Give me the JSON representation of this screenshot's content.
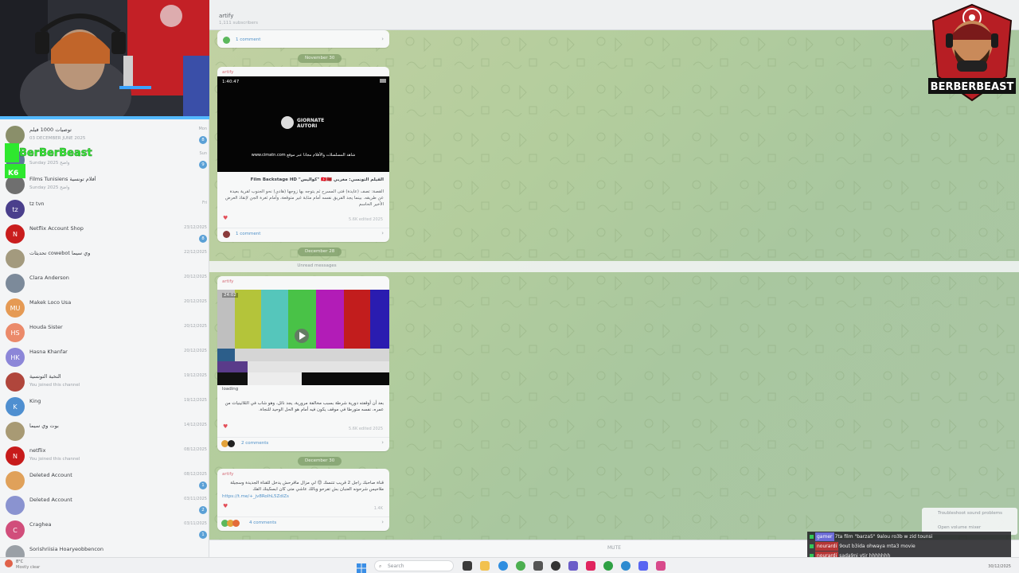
{
  "sidebar": {
    "chats": [
      {
        "name": "توصيات 1000 فيلم",
        "preview": "03 DECEMBER JUNE 2025",
        "date": "Mon",
        "badge": "8",
        "avatar_color": "#8a8f6a",
        "avatar_text": ""
      },
      {
        "name": "",
        "preview": "Sunday 2025 واضح",
        "date": "Sun",
        "badge": "9",
        "avatar_color": "#5d7a98",
        "avatar_text": ""
      },
      {
        "name": "Films Tunisiens أفلام تونسية",
        "preview": "Sunday 2025 واضح",
        "date": "",
        "badge": "",
        "avatar_color": "#6f6f6f",
        "avatar_text": ""
      },
      {
        "name": "tz tvn",
        "preview": "",
        "date": "Fri",
        "badge": "",
        "avatar_color": "#4a3f8c",
        "avatar_text": "tz"
      },
      {
        "name": "Netflix Account Shop",
        "preview": "",
        "date": "23/12/2025",
        "badge": "8",
        "avatar_color": "#c91d1d",
        "avatar_text": "N"
      },
      {
        "name": "تحديثات cowebot وي سيما",
        "preview": "",
        "date": "22/12/2025",
        "badge": "",
        "avatar_color": "#a39a7e",
        "avatar_text": ""
      },
      {
        "name": "Clara Anderson",
        "preview": "",
        "date": "20/12/2025",
        "badge": "",
        "avatar_color": "#7c8a9a",
        "avatar_text": ""
      },
      {
        "name": "Makek Loco Usa",
        "preview": "",
        "date": "20/12/2025",
        "badge": "",
        "avatar_color": "#e59a54",
        "avatar_text": "MU"
      },
      {
        "name": "Houda Sister",
        "preview": "",
        "date": "20/12/2025",
        "badge": "",
        "avatar_color": "#eb8a6a",
        "avatar_text": "HS"
      },
      {
        "name": "Hasna Khanfar",
        "preview": "",
        "date": "20/12/2025",
        "badge": "",
        "avatar_color": "#8c86d8",
        "avatar_text": "HK"
      },
      {
        "name": "النخبة التونسية",
        "preview": "You joined this channel",
        "date": "19/12/2025",
        "badge": "",
        "avatar_color": "#b0463c",
        "avatar_text": ""
      },
      {
        "name": "King",
        "preview": "",
        "date": "19/12/2025",
        "badge": "",
        "avatar_color": "#4f8fd0",
        "avatar_text": "K"
      },
      {
        "name": "بوت وي سيما",
        "preview": "",
        "date": "14/12/2025",
        "badge": "",
        "avatar_color": "#a89a74",
        "avatar_text": ""
      },
      {
        "name": "netflix",
        "preview": "You joined this channel",
        "date": "08/12/2025",
        "badge": "",
        "avatar_color": "#c71b1b",
        "avatar_text": "N"
      },
      {
        "name": "Deleted Account",
        "preview": "",
        "date": "08/12/2025",
        "badge": "1",
        "avatar_color": "#e0a15a",
        "avatar_text": ""
      },
      {
        "name": "Deleted Account",
        "preview": "",
        "date": "03/11/2025",
        "badge": "2",
        "avatar_color": "#8a93d0",
        "avatar_text": ""
      },
      {
        "name": "Craghea",
        "preview": "",
        "date": "03/11/2025",
        "badge": "1",
        "avatar_color": "#d14e7b",
        "avatar_text": "C"
      },
      {
        "name": "Sorishriisia Hoaryeobbencon",
        "preview": "",
        "date": "",
        "badge": "",
        "avatar_color": "#9aa0a6",
        "avatar_text": ""
      }
    ],
    "overlay_name": "BerBerBeast"
  },
  "header": {
    "title": "artify",
    "subtitle": "1,111 subscribers"
  },
  "chat": {
    "top_comment": "1 comment",
    "date1": "November 30",
    "date2": "December 28",
    "unread": "Unread messages",
    "date3": "December 30",
    "msg1": {
      "sender": "artify",
      "duration": "1:40:47",
      "video_text": "GIORNATE AUTORI",
      "video_caption": "شاهد المسلسلات والأفلام مجانا عبر موقع www.cimatn.com",
      "title": "الفيلم التونسي: مغربي 🇹🇳🇲🇦 \"كواليس\" Film Backstage HD",
      "body": "القصة: تصف (عايدة) فتى المسرح ثم يتوجه بها زوجها (هادي) نحو الجنوب لقرية بعيدة عن طريقه. بينما يجد الفريق نفسه أمام مثابة غير متوقعة، وأمام ثغرة الجن لإنقاذ العرض الأخير الحاسم",
      "views": "5.6K edited 2025",
      "comment": "1 comment"
    },
    "msg2": {
      "sender": "artify",
      "duration": "24:02",
      "loading": "loading",
      "body": "بعد أن أوقفته دورية شرطة بسبب مخالفة مرورية، يجد نائل، وهو شاب في الثلاثينيات من عمره، نفسه متورطا في موقف يكون فيه أمام هو الحل الوحيد للنجاة.",
      "views": "5.6K edited 2025",
      "comment": "2 comments"
    },
    "msg3": {
      "sender": "artify",
      "body": "قناة صاحبك راجل 2 قريب تتنسك 😊 لي مزال ماقرحش يدخل للقناة الجديدة وسجيلة ملاحيس شرحونه العنبان بش تفرحو وبالك عاشي متى كان ابسكينك الفك",
      "link": "https://t.me/+_jv8RoIhL5ZdiZs",
      "views": "1.4K",
      "comment": "4 comments"
    },
    "mute": "MUTE"
  },
  "stream_chat": [
    {
      "user": "gamer",
      "text": "7ta film \"barza5\" 9alou ro3b w zid tounsi"
    },
    {
      "user": "nourardi",
      "text": "9out b3ida ohwaya mta3 movie"
    },
    {
      "user": "nourardi",
      "text": "sada9ni ytir hhhhhhh"
    }
  ],
  "context_menu": {
    "item1": "Troubleshoot sound problems",
    "item2": "Open volume mixer"
  },
  "taskbar": {
    "search": "Search",
    "weather": "Mostly clear",
    "temp": "8°C",
    "date": "30/12/2025"
  },
  "logo_text": "BERBERBEAST",
  "colors": {
    "accent": "#4e90c8",
    "sender": "#d56e79",
    "twitch_green": "#34c759"
  }
}
